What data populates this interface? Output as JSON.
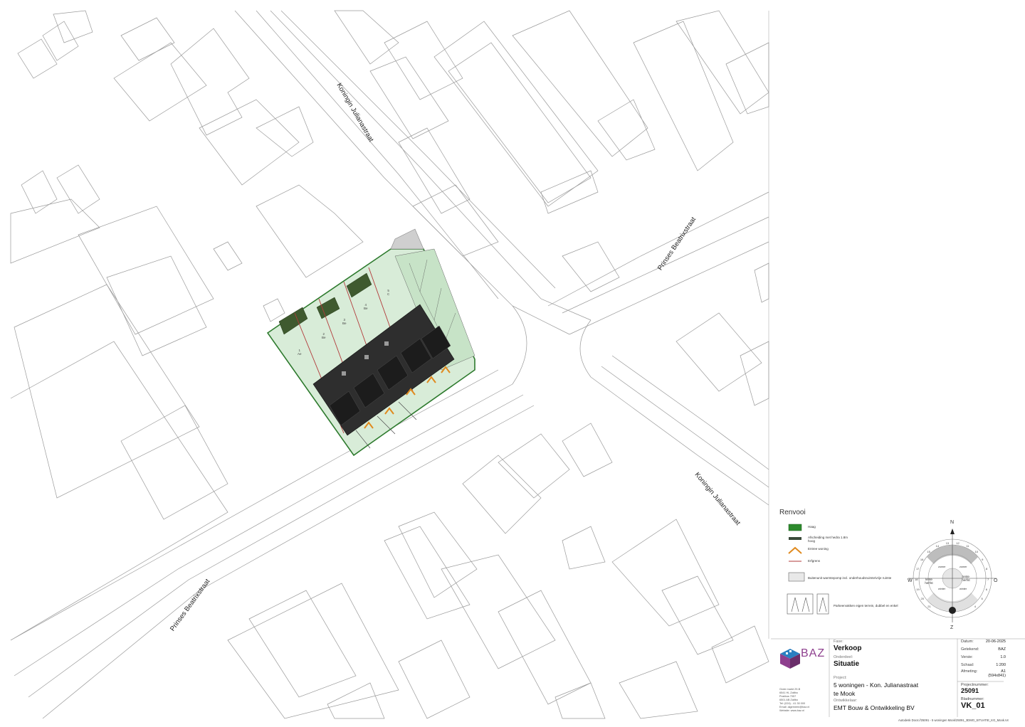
{
  "streets": {
    "julianastraat_north": "Koningin Julianastraat",
    "beatrixstraat_east": "Prinses Beatrixstraat",
    "julianastraat_south": "Koningin Julianastraat",
    "beatrixstraat_south": "Prinses Beatrixstraat"
  },
  "plots": [
    {
      "number": "1",
      "type": "Ae"
    },
    {
      "number": "2",
      "type": "Be"
    },
    {
      "number": "3",
      "type": "Be"
    },
    {
      "number": "4",
      "type": "Be"
    },
    {
      "number": "5",
      "type": "C"
    }
  ],
  "legend": {
    "title": "Renvooi",
    "items": [
      {
        "label": "Haag",
        "icon": "hedge-symbol"
      },
      {
        "label": "Afscheiding met hedra 1.8m hoog",
        "icon": "fence-symbol"
      },
      {
        "label": "Entree woning",
        "icon": "entrance-chevron"
      },
      {
        "label": "Erfgrens",
        "icon": "property-line"
      },
      {
        "label": "Buitenunit warmtepomp incl. onderhoudsruimte/vrije ruimte",
        "icon": "heatpump-unit"
      },
      {
        "label": "Parkeervakken eigen terrein, dubbel en enkel",
        "icon": "parking-bays"
      }
    ]
  },
  "compass": {
    "north": "N",
    "east": "O",
    "south": "Z",
    "west": "W",
    "season_left": "lente herfst",
    "season_right": "lente herfst",
    "ring_zomer_1": "zomer",
    "ring_zomer_2": "zomer",
    "ring_winter_1": "winter",
    "ring_winter_2": "winter",
    "hours": [
      "4",
      "5",
      "6",
      "7",
      "8",
      "9",
      "10",
      "11",
      "12",
      "13",
      "14",
      "15",
      "16",
      "17",
      "18",
      "19",
      "20",
      "21"
    ]
  },
  "titleblock": {
    "fase_label": "Fase:",
    "fase_value": "Verkoop",
    "onderdeel_label": "Onderdeel:",
    "onderdeel_value": "Situatie",
    "project_label": "Project:",
    "project_line1": "5 woningen - Kon. Julianastraat",
    "project_line2": "te Mook",
    "ontwikkelaar_label": "Ontwikkelaar:",
    "ontwikkelaar_value": "EMT Bouw & Ontwikkeling BV",
    "datum_label": "Datum:",
    "datum_value": "20-06-2025",
    "getekend_label": "Getekend:",
    "getekend_value": "BAZ",
    "versie_label": "Versie:",
    "versie_value": "1.0",
    "schaal_label": "Schaal:",
    "schaal_value": "1:200",
    "afmeting_label": "Afmeting:",
    "afmeting_value": "A1",
    "afmeting_sub": "(594x841)",
    "projectnummer_label": "Projectnummer:",
    "projectnummer_value": "25091",
    "bladnummer_label": "Bladnummer:",
    "bladnummer_value": "VK_01",
    "logo_text": "BAZ",
    "office_lines": [
      "Grote markt 29-B",
      "6541 HL Zaltbo",
      "Postbus 7057",
      "6501 AB Zaltbo",
      "Tel: (024) - 41 30 000",
      "Email: algemeen@baz.nl",
      "Website: www.baz.nl"
    ],
    "colors": {
      "logo_purple": "#8e3f8e",
      "logo_blue": "#2a7fc1"
    }
  },
  "footer_path": "Autodesk Docs://25091 - 5 woningen Mook/25091_3DMO_SITUATIE_KG_Mook.rvt"
}
